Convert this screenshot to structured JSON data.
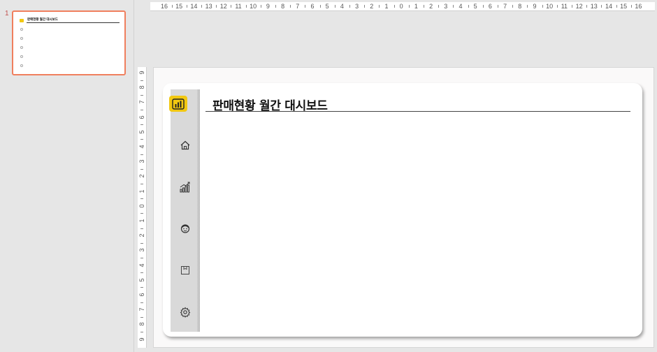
{
  "thumbnail": {
    "number": "1",
    "title": "판매현황 월간 대시보드"
  },
  "ruler": {
    "horizontal_labels": [
      "16",
      "15",
      "14",
      "13",
      "12",
      "11",
      "10",
      "9",
      "8",
      "7",
      "6",
      "5",
      "4",
      "3",
      "2",
      "1",
      "0",
      "1",
      "2",
      "3",
      "4",
      "5",
      "6",
      "7",
      "8",
      "9",
      "10",
      "11",
      "12",
      "13",
      "14",
      "15",
      "16"
    ],
    "vertical_labels": [
      "9",
      "8",
      "7",
      "6",
      "5",
      "4",
      "3",
      "2",
      "1",
      "0",
      "1",
      "2",
      "3",
      "4",
      "5",
      "6",
      "7",
      "8",
      "9"
    ]
  },
  "slide": {
    "title": "판매현황 월간 대시보드",
    "sidebar_icons": [
      "power-bi-logo-icon",
      "home-icon",
      "chart-growth-icon",
      "customer-icon",
      "product-box-icon",
      "settings-gear-icon"
    ]
  },
  "colors": {
    "accent_yellow": "#f2c811",
    "thumbnail_selection": "#f07f5e",
    "sidebar_gray": "#d9d9d9"
  }
}
